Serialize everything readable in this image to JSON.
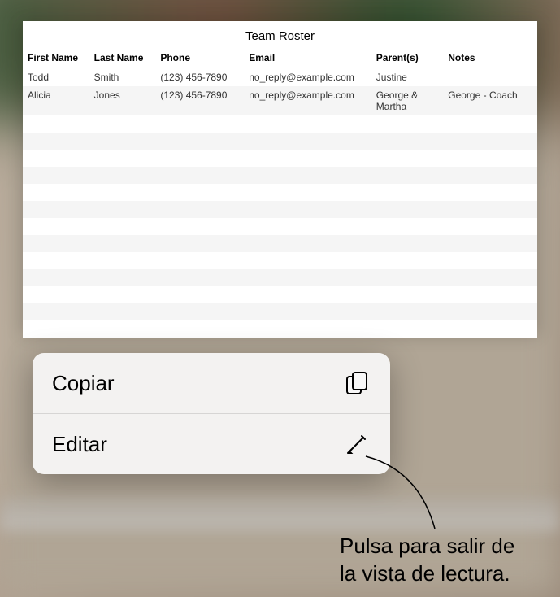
{
  "document": {
    "title": "Team Roster",
    "columns": {
      "firstname": "First Name",
      "lastname": "Last Name",
      "phone": "Phone",
      "email": "Email",
      "parents": "Parent(s)",
      "notes": "Notes"
    },
    "rows": [
      {
        "firstname": "Todd",
        "lastname": "Smith",
        "phone": "(123) 456-7890",
        "email": "no_reply@example.com",
        "parents": "Justine",
        "notes": ""
      },
      {
        "firstname": "Alicia",
        "lastname": "Jones",
        "phone": "(123) 456-7890",
        "email": "no_reply@example.com",
        "parents": "George & Martha",
        "notes": "George - Coach"
      }
    ]
  },
  "menu": {
    "copy_label": "Copiar",
    "edit_label": "Editar"
  },
  "callout": {
    "line1": "Pulsa para salir de",
    "line2": "la vista de lectura."
  }
}
